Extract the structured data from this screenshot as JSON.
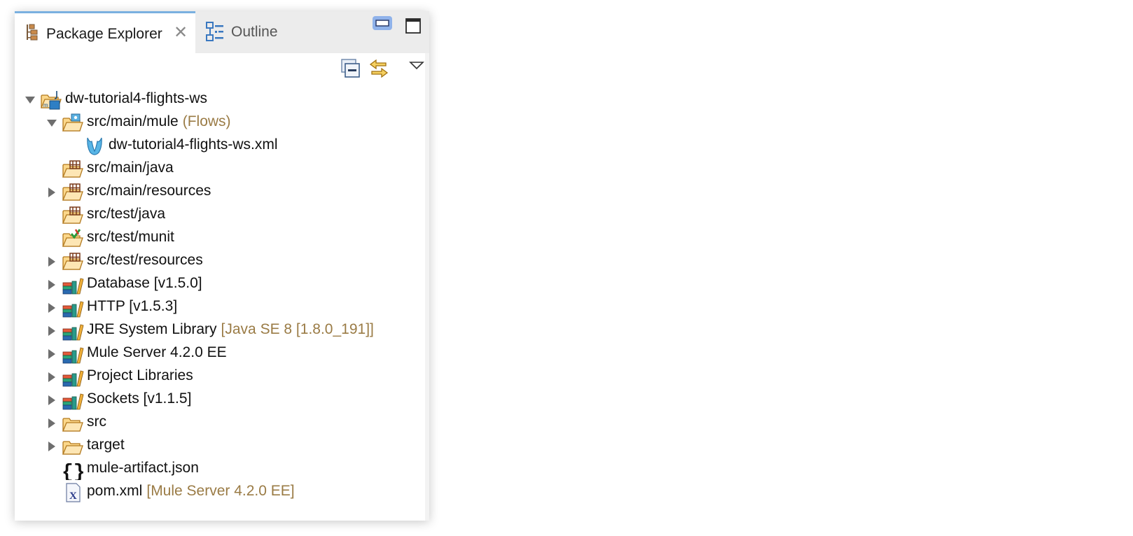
{
  "tabs": {
    "package_explorer": "Package Explorer",
    "outline": "Outline"
  },
  "colors": {
    "decoration": "#9a7b45",
    "accent": "#7ab0e0"
  },
  "tree": [
    {
      "label": "dw-tutorial4-flights-ws",
      "decoration": "",
      "expander": "expanded",
      "icon": "project-icon",
      "level": 0
    },
    {
      "label": "src/main/mule",
      "decoration": "(Flows)",
      "expander": "expanded",
      "icon": "mule-flows-folder-icon",
      "level": 1
    },
    {
      "label": "dw-tutorial4-flights-ws.xml",
      "decoration": "",
      "expander": "none",
      "icon": "mule-config-file-icon",
      "level": 2
    },
    {
      "label": "src/main/java",
      "decoration": "",
      "expander": "none",
      "icon": "source-folder-icon",
      "level": 1
    },
    {
      "label": "src/main/resources",
      "decoration": "",
      "expander": "collapsed",
      "icon": "source-folder-icon",
      "level": 1
    },
    {
      "label": "src/test/java",
      "decoration": "",
      "expander": "none",
      "icon": "source-folder-icon",
      "level": 1
    },
    {
      "label": "src/test/munit",
      "decoration": "",
      "expander": "none",
      "icon": "munit-folder-icon",
      "level": 1
    },
    {
      "label": "src/test/resources",
      "decoration": "",
      "expander": "collapsed",
      "icon": "source-folder-icon",
      "level": 1
    },
    {
      "label": "Database [v1.5.0]",
      "decoration": "",
      "expander": "collapsed",
      "icon": "library-icon",
      "level": 1
    },
    {
      "label": "HTTP [v1.5.3]",
      "decoration": "",
      "expander": "collapsed",
      "icon": "library-icon",
      "level": 1
    },
    {
      "label": "JRE System Library",
      "decoration": "[Java SE 8 [1.8.0_191]]",
      "expander": "collapsed",
      "icon": "library-icon",
      "level": 1
    },
    {
      "label": "Mule Server 4.2.0 EE",
      "decoration": "",
      "expander": "collapsed",
      "icon": "library-icon",
      "level": 1
    },
    {
      "label": "Project Libraries",
      "decoration": "",
      "expander": "collapsed",
      "icon": "library-icon",
      "level": 1
    },
    {
      "label": "Sockets [v1.1.5]",
      "decoration": "",
      "expander": "collapsed",
      "icon": "library-icon",
      "level": 1
    },
    {
      "label": "src",
      "decoration": "",
      "expander": "collapsed",
      "icon": "folder-icon",
      "level": 1
    },
    {
      "label": "target",
      "decoration": "",
      "expander": "collapsed",
      "icon": "folder-icon",
      "level": 1
    },
    {
      "label": "mule-artifact.json",
      "decoration": "",
      "expander": "none",
      "icon": "json-file-icon",
      "level": 1
    },
    {
      "label": "pom.xml",
      "decoration": "[Mule Server 4.2.0 EE]",
      "expander": "none",
      "icon": "xml-file-icon",
      "level": 1
    }
  ]
}
